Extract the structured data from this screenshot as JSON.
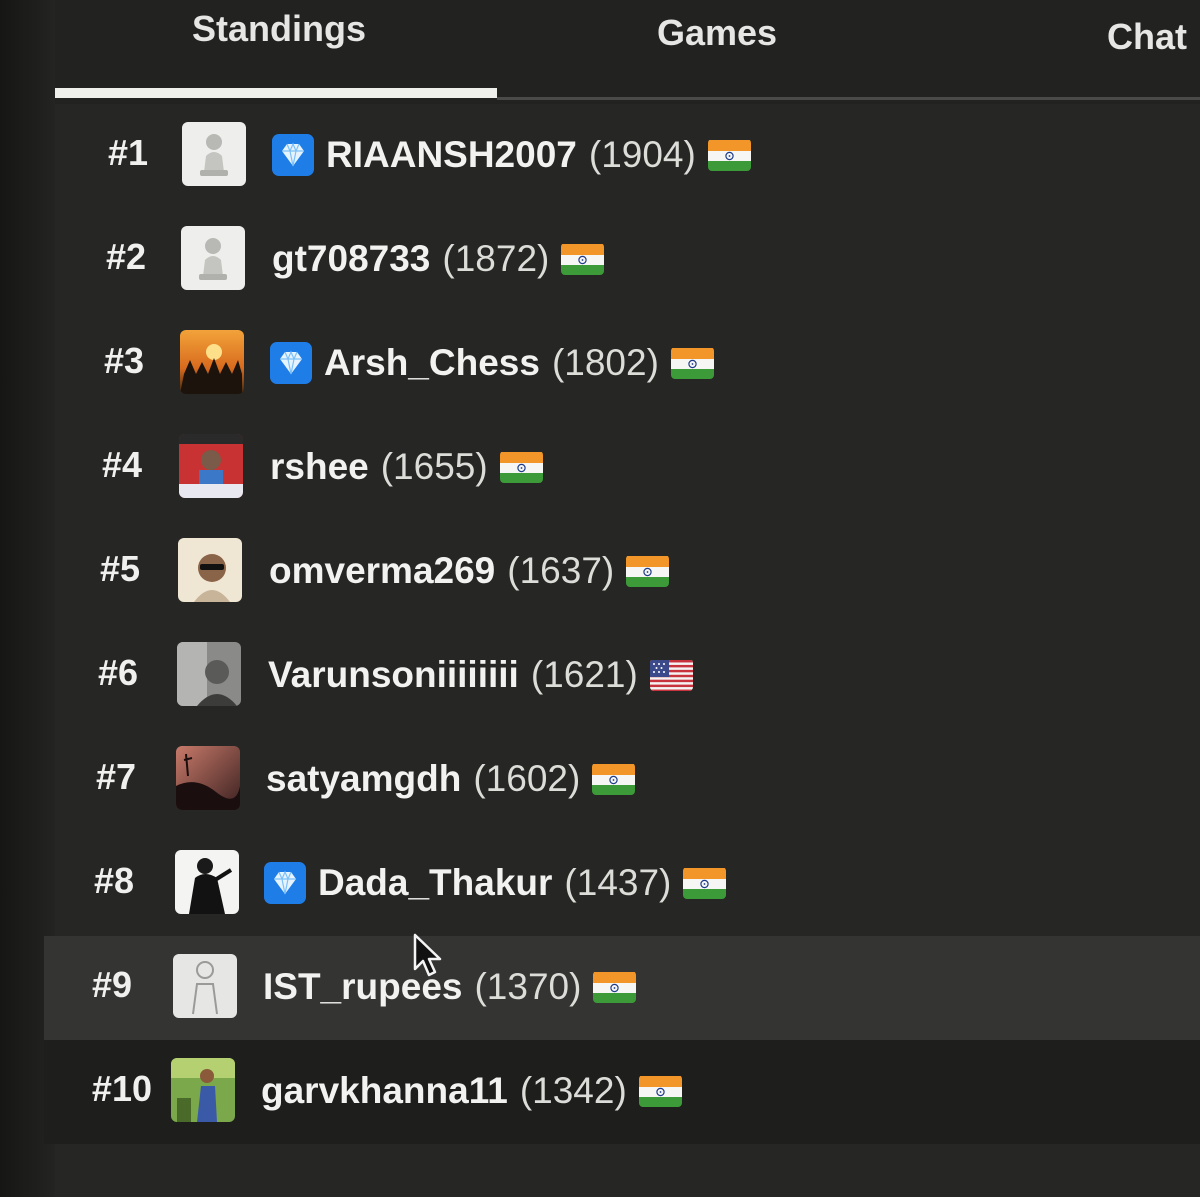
{
  "tabs": [
    {
      "label": "Standings",
      "active": true
    },
    {
      "label": "Games",
      "active": false
    },
    {
      "label": "Chat",
      "active": false
    }
  ],
  "standings": [
    {
      "rank": "#1",
      "username": "RIAANSH2007",
      "rating": "(1904)",
      "patron": true,
      "flag": "india",
      "avatar": "pawn"
    },
    {
      "rank": "#2",
      "username": "gt708733",
      "rating": "(1872)",
      "patron": false,
      "flag": "india",
      "avatar": "pawn"
    },
    {
      "rank": "#3",
      "username": "Arsh_Chess",
      "rating": "(1802)",
      "patron": true,
      "flag": "india",
      "avatar": "sunset-chess"
    },
    {
      "rank": "#4",
      "username": "rshee",
      "rating": "(1655)",
      "patron": false,
      "flag": "india",
      "avatar": "photo-red"
    },
    {
      "rank": "#5",
      "username": "omverma269",
      "rating": "(1637)",
      "patron": false,
      "flag": "india",
      "avatar": "photo-sunglasses"
    },
    {
      "rank": "#6",
      "username": "Varunsoniiiiiiii",
      "rating": "(1621)",
      "patron": false,
      "flag": "usa",
      "avatar": "photo-gray"
    },
    {
      "rank": "#7",
      "username": "satyamgdh",
      "rating": "(1602)",
      "patron": false,
      "flag": "india",
      "avatar": "photo-dusk"
    },
    {
      "rank": "#8",
      "username": "Dada_Thakur",
      "rating": "(1437)",
      "patron": true,
      "flag": "india",
      "avatar": "photo-bw"
    },
    {
      "rank": "#9",
      "username": "IST_rupees",
      "rating": "(1370)",
      "patron": false,
      "flag": "india",
      "avatar": "photo-sketch"
    },
    {
      "rank": "#10",
      "username": "garvkhanna11",
      "rating": "(1342)",
      "patron": false,
      "flag": "india",
      "avatar": "photo-outdoor"
    }
  ],
  "icons": {
    "patron": "diamond-icon",
    "cursor": "mouse-pointer-icon"
  },
  "colors": {
    "background": "#262624",
    "patron_badge": "#1f7de8",
    "hover_row": "#343432",
    "active_tab_underline": "#efefec"
  }
}
